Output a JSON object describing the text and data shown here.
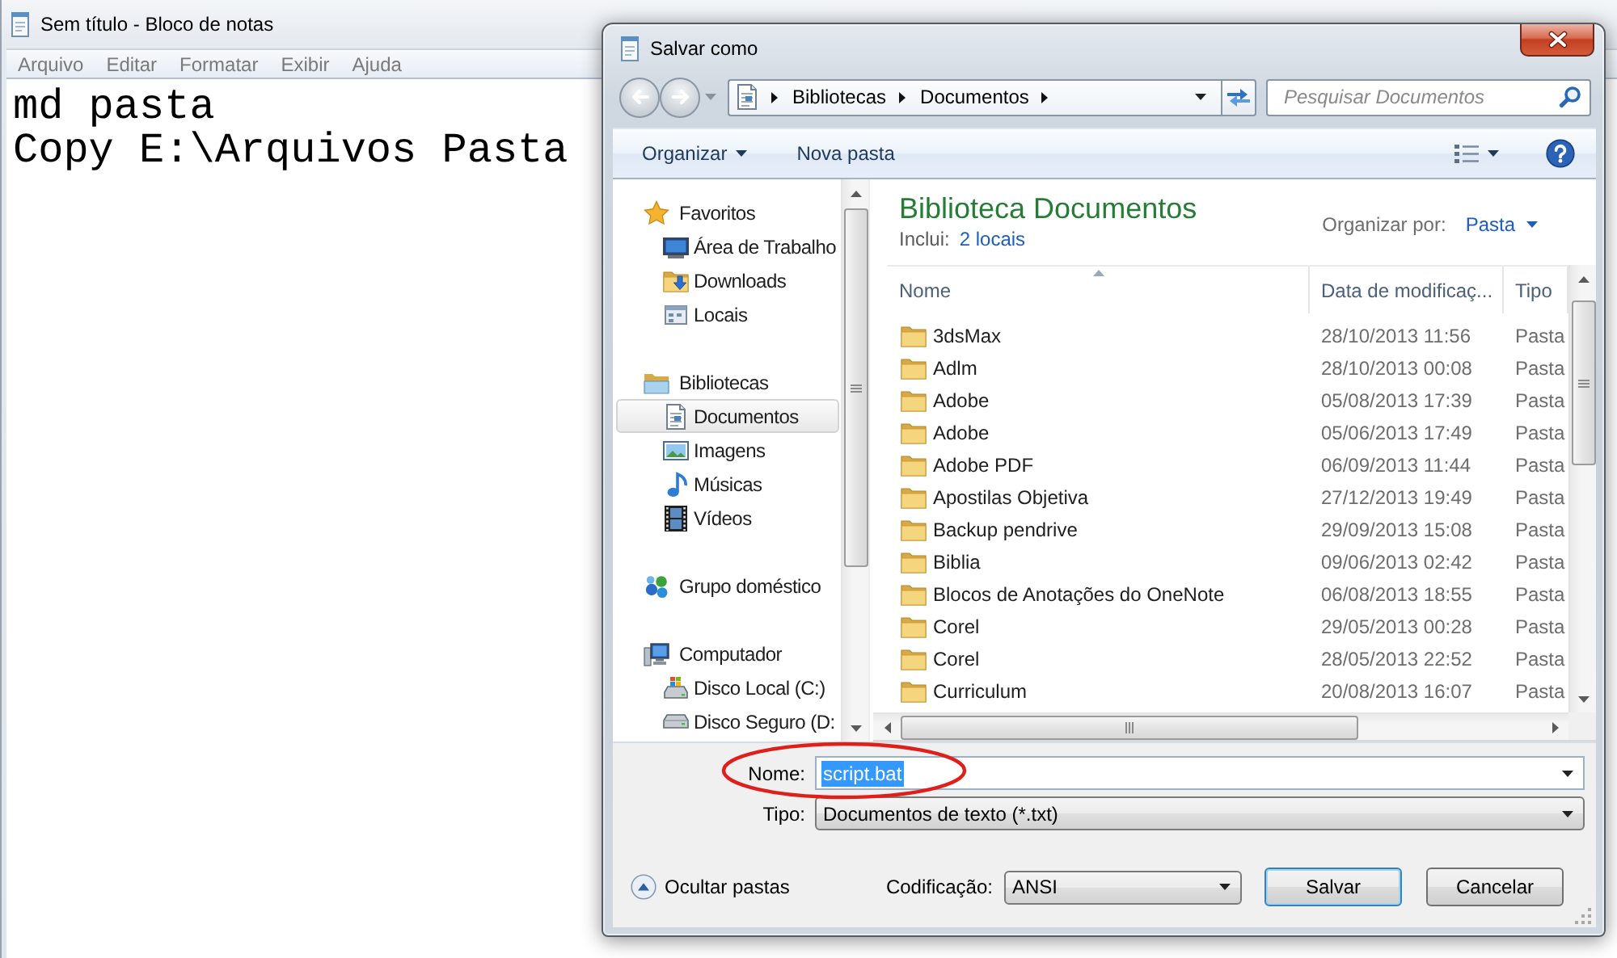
{
  "notepad": {
    "title": "Sem título - Bloco de notas",
    "active": false,
    "menu": [
      "Arquivo",
      "Editar",
      "Formatar",
      "Exibir",
      "Ajuda"
    ],
    "lines": [
      "md pasta",
      "Copy E:\\Arquivos Pasta"
    ]
  },
  "dialog": {
    "title": "Salvar como",
    "history": {
      "back_disabled": true,
      "forward_disabled": true
    },
    "address": {
      "crumbs": [
        "Bibliotecas",
        "Documentos"
      ]
    },
    "search": {
      "placeholder": "Pesquisar Documentos"
    },
    "toolbar": {
      "buttons": [
        {
          "label": "Organizar",
          "kind": "menu"
        },
        {
          "label": "Nova pasta",
          "kind": "command"
        }
      ]
    },
    "nav_pane": {
      "items": [
        {
          "label": "Favoritos",
          "kind": "favorites",
          "selected": false,
          "children": [
            {
              "label": "Área de Trabalho",
              "kind": "desktop",
              "selected": false
            },
            {
              "label": "Downloads",
              "kind": "downloads",
              "selected": false
            },
            {
              "label": "Locais",
              "kind": "places",
              "selected": false
            }
          ]
        },
        {
          "label": "Bibliotecas",
          "kind": "libraries",
          "selected": false,
          "children": [
            {
              "label": "Documentos",
              "kind": "documents",
              "selected": true
            },
            {
              "label": "Imagens",
              "kind": "pictures",
              "selected": false
            },
            {
              "label": "Músicas",
              "kind": "music",
              "selected": false
            },
            {
              "label": "Vídeos",
              "kind": "videos",
              "selected": false
            }
          ]
        },
        {
          "label": "Grupo doméstico",
          "kind": "homegroup",
          "selected": false
        },
        {
          "label": "Computador",
          "kind": "computer",
          "selected": false,
          "children": [
            {
              "label": "Disco Local (C:)",
              "kind": "system_drive",
              "selected": false
            },
            {
              "label": "Disco Seguro (D:",
              "kind": "drive",
              "selected": false
            }
          ]
        }
      ]
    },
    "library": {
      "title": "Biblioteca Documentos",
      "includes_label": "Inclui:",
      "includes_link": "2 locais",
      "arrange_label": "Organizar por:",
      "arrange_value": "Pasta"
    },
    "file_list": {
      "columns": [
        {
          "label": "Nome",
          "sorted": true
        },
        {
          "label": "Data de modificaç...",
          "sorted": false
        },
        {
          "label": "Tipo",
          "sorted": false
        }
      ],
      "rows": [
        {
          "name": "3dsMax",
          "modified": "28/10/2013 11:56",
          "type": "Pasta",
          "selected": false
        },
        {
          "name": "Adlm",
          "modified": "28/10/2013 00:08",
          "type": "Pasta",
          "selected": false
        },
        {
          "name": "Adobe",
          "modified": "05/08/2013 17:39",
          "type": "Pasta",
          "selected": false
        },
        {
          "name": "Adobe",
          "modified": "05/06/2013 17:49",
          "type": "Pasta",
          "selected": false
        },
        {
          "name": "Adobe PDF",
          "modified": "06/09/2013 11:44",
          "type": "Pasta",
          "selected": false
        },
        {
          "name": "Apostilas Objetiva",
          "modified": "27/12/2013 19:49",
          "type": "Pasta",
          "selected": false
        },
        {
          "name": "Backup pendrive",
          "modified": "29/09/2013 15:08",
          "type": "Pasta",
          "selected": false
        },
        {
          "name": "Biblia",
          "modified": "09/06/2013 02:42",
          "type": "Pasta",
          "selected": false
        },
        {
          "name": "Blocos de Anotações do OneNote",
          "modified": "06/08/2013 18:55",
          "type": "Pasta",
          "selected": false
        },
        {
          "name": "Corel",
          "modified": "29/05/2013 00:28",
          "type": "Pasta",
          "selected": false
        },
        {
          "name": "Corel",
          "modified": "28/05/2013 22:52",
          "type": "Pasta",
          "selected": false
        },
        {
          "name": "Curriculum",
          "modified": "20/08/2013 16:07",
          "type": "Pasta",
          "selected": false
        }
      ]
    },
    "save_form": {
      "name_label": "Nome:",
      "name_value": "script.bat",
      "name_value_selected": true,
      "type_label": "Tipo:",
      "type_value": "Documentos de texto (*.txt)",
      "hide_folders": "Ocultar pastas",
      "encoding_label": "Codificação:",
      "encoding_value": "ANSI",
      "buttons": [
        {
          "label": "Salvar",
          "default": true
        },
        {
          "label": "Cancelar",
          "default": false
        }
      ]
    }
  },
  "annotation": {
    "kind": "ellipse"
  }
}
